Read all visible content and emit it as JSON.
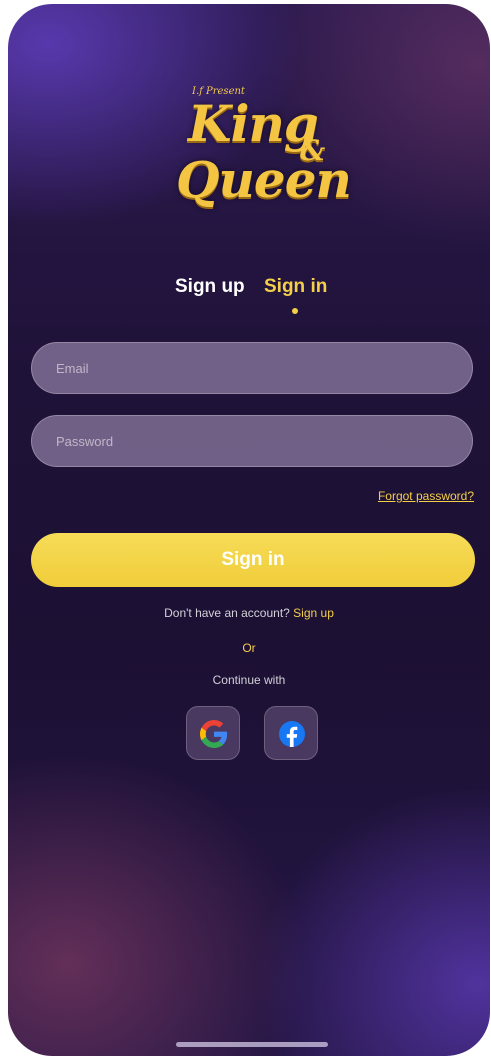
{
  "logo": {
    "tagline": "I.f Present",
    "line1": "King",
    "ampersand": "&",
    "line2": "Queen"
  },
  "tabs": [
    {
      "label": "Sign up",
      "active": false
    },
    {
      "label": "Sign in",
      "active": true
    }
  ],
  "form": {
    "email_placeholder": "Email",
    "email_value": "",
    "password_placeholder": "Password",
    "password_value": ""
  },
  "forgot_password": "Forgot password?",
  "submit_label": "Sign in",
  "account_prompt": {
    "text": "Don't have an account?",
    "link": "Sign up"
  },
  "or_text": "Or",
  "continue_text": "Continue with",
  "social": [
    {
      "icon": "google-icon"
    },
    {
      "icon": "facebook-icon"
    }
  ],
  "colors": {
    "accent": "#f4cf4a",
    "facebook_blue": "#1877f2"
  }
}
